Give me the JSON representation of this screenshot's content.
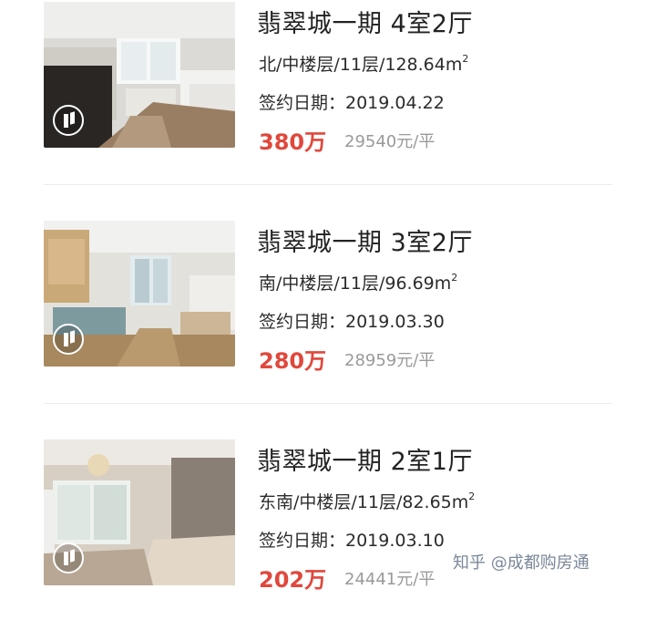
{
  "listings": [
    {
      "title": "翡翠城一期 4室2厅",
      "info_text": "北/中楼层/11层/128.64m",
      "info_unit_sup": "2",
      "date": "签约日期：2019.04.22",
      "price": "380万",
      "unit_price": "29540元/平"
    },
    {
      "title": "翡翠城一期 3室2厅",
      "info_text": "南/中楼层/11层/96.69m",
      "info_unit_sup": "2",
      "date": "签约日期：2019.03.30",
      "price": "280万",
      "unit_price": "28959元/平"
    },
    {
      "title": "翡翠城一期 2室1厅",
      "info_text": "东南/中楼层/11层/82.65m",
      "info_unit_sup": "2",
      "date": "签约日期：2019.03.10",
      "price": "202万",
      "unit_price": "24441元/平"
    }
  ],
  "watermark": "知乎 @成都购房通",
  "colors": {
    "price": "#e0483c",
    "unit_price": "#9a9a9a",
    "text": "#2b2b2b",
    "divider": "#ececec"
  },
  "icons": [
    "video-play-icon"
  ]
}
